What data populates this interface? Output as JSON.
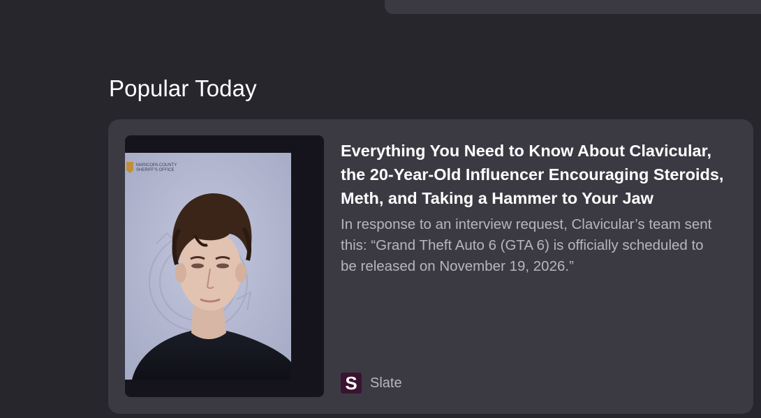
{
  "section": {
    "title": "Popular Today"
  },
  "article": {
    "headline": "Everything You Need to Know About Clavicular, the 20-Year-Old Influencer Encouraging Steroids, Meth, and Taking a Hammer to Your Jaw",
    "excerpt": "In response to an interview request, Clavicular’s team sent this: “Grand Theft Auto 6 (GTA 6) is officially scheduled to be released on November 19, 2026.”",
    "image": {
      "badge_line1": "MARICOPA COUNTY",
      "badge_line2": "SHERIFF'S OFFICE"
    },
    "source": {
      "logo_letter": "S",
      "name": "Slate",
      "logo_color": "#3a1330"
    }
  },
  "colors": {
    "page_background": "#27262d",
    "card_background": "#3b3a43",
    "headline_text": "#ffffff",
    "muted_text": "#b7b6bd"
  }
}
